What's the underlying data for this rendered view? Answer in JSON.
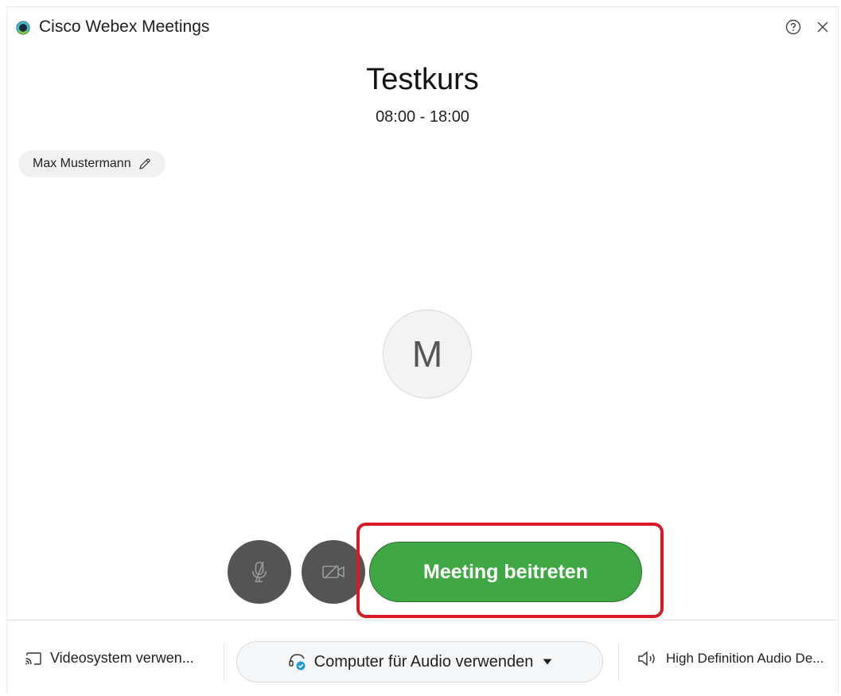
{
  "window": {
    "app_title": "Cisco Webex Meetings",
    "icons": {
      "logo": "webex-logo-icon",
      "help": "help-icon",
      "close": "close-icon"
    }
  },
  "meeting": {
    "title": "Testkurs",
    "time": "08:00 - 18:00"
  },
  "user": {
    "name": "Max Mustermann",
    "initial": "M"
  },
  "controls": {
    "mute_icon": "microphone-muted-icon",
    "video_icon": "video-off-icon",
    "join_label": "Meeting beitreten"
  },
  "footer": {
    "video_system_label": "Videosystem verwen...",
    "audio_label": "Computer für Audio verwenden",
    "speaker_label": "High Definition Audio De..."
  },
  "colors": {
    "join_green": "#3fa844",
    "highlight_red": "#d71a24",
    "control_gray": "#545454"
  }
}
